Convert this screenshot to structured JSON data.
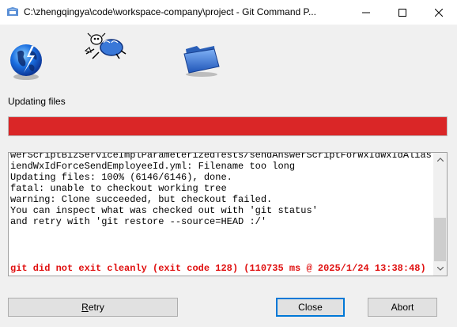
{
  "window": {
    "title": "C:\\zhengqingya\\code\\workspace-company\\project - Git Command P..."
  },
  "icons": [
    "globe-icon",
    "sheep-icon",
    "folder-icon"
  ],
  "status": {
    "label": "Updating files",
    "progress_fraction": 1.0,
    "progress_color": "#da2627"
  },
  "log": {
    "lines": [
      "werScriptBizServiceImplParameterizedTests/sendAnswerScriptForWxIdWxIdAliasFr",
      "iendWxIdForceSendEmployeeId.yml: Filename too long",
      "Updating files: 100% (6146/6146), done.",
      "fatal: unable to checkout working tree",
      "warning: Clone succeeded, but checkout failed.",
      "You can inspect what was checked out with 'git status'",
      "and retry with 'git restore --source=HEAD :/'"
    ],
    "error": "git did not exit cleanly (exit code 128) (110735 ms @ 2025/1/24 13:38:48)",
    "error_color": "#e01010"
  },
  "buttons": {
    "retry_first": "R",
    "retry_rest": "etry",
    "close": "Close",
    "abort": "Abort"
  }
}
